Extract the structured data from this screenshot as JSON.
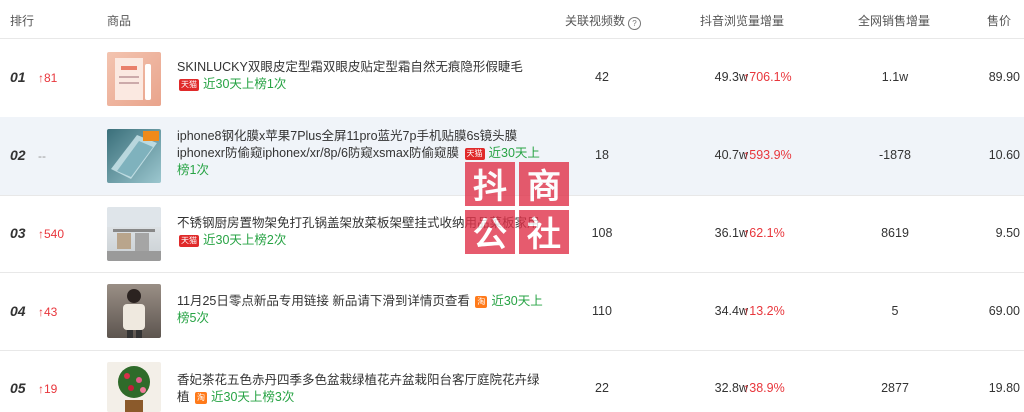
{
  "headers": {
    "rank": "排行",
    "product": "商品",
    "videos": "关联视频数",
    "views": "抖音浏览量增量",
    "sales": "全网销售增量",
    "price": "售价"
  },
  "rows": [
    {
      "rank": "01",
      "change": "↑81",
      "title": "SKINLUCKY双眼皮定型霜双眼皮贴定型霜自然无痕隐形假睫毛",
      "badge": "天猫",
      "days": "近30天上榜1次",
      "videos": "42",
      "views": "49.3w",
      "views_change": "↑706.1%",
      "sales": "1.1w",
      "price": "89.90"
    },
    {
      "rank": "02",
      "change": "--",
      "title": "iphone8钢化膜x苹果7Plus全屏11pro蓝光7p手机贴膜6s镜头膜iphonexr防偷窥iphonex/xr/8p/6防窥xsmax防偷窥膜",
      "badge": "天猫",
      "days": "近30天上榜1次",
      "videos": "18",
      "views": "40.7w",
      "views_change": "↑593.9%",
      "sales": "-1878",
      "price": "10.60"
    },
    {
      "rank": "03",
      "change": "↑540",
      "title": "不锈钢厨房置物架免打孔锅盖架放菜板架壁挂式收纳用品菜板家用",
      "badge": "天猫",
      "days": "近30天上榜2次",
      "videos": "108",
      "views": "36.1w",
      "views_change": "↑62.1%",
      "sales": "8619",
      "price": "9.50"
    },
    {
      "rank": "04",
      "change": "↑43",
      "title": "11月25日零点新品专用链接 新品请下滑到详情页查看",
      "badge": "淘",
      "days": "近30天上榜5次",
      "videos": "110",
      "views": "34.4w",
      "views_change": "↑13.2%",
      "sales": "5",
      "price": "69.00"
    },
    {
      "rank": "05",
      "change": "↑19",
      "title": "香妃茶花五色赤丹四季多色盆栽绿植花卉盆栽阳台客厅庭院花卉绿植",
      "badge": "淘",
      "days": "近30天上榜3次",
      "videos": "22",
      "views": "32.8w",
      "views_change": "↑38.9%",
      "sales": "2877",
      "price": "19.80"
    }
  ],
  "watermark": "抖商公社",
  "icons": {
    "help": "question-circle-icon"
  }
}
